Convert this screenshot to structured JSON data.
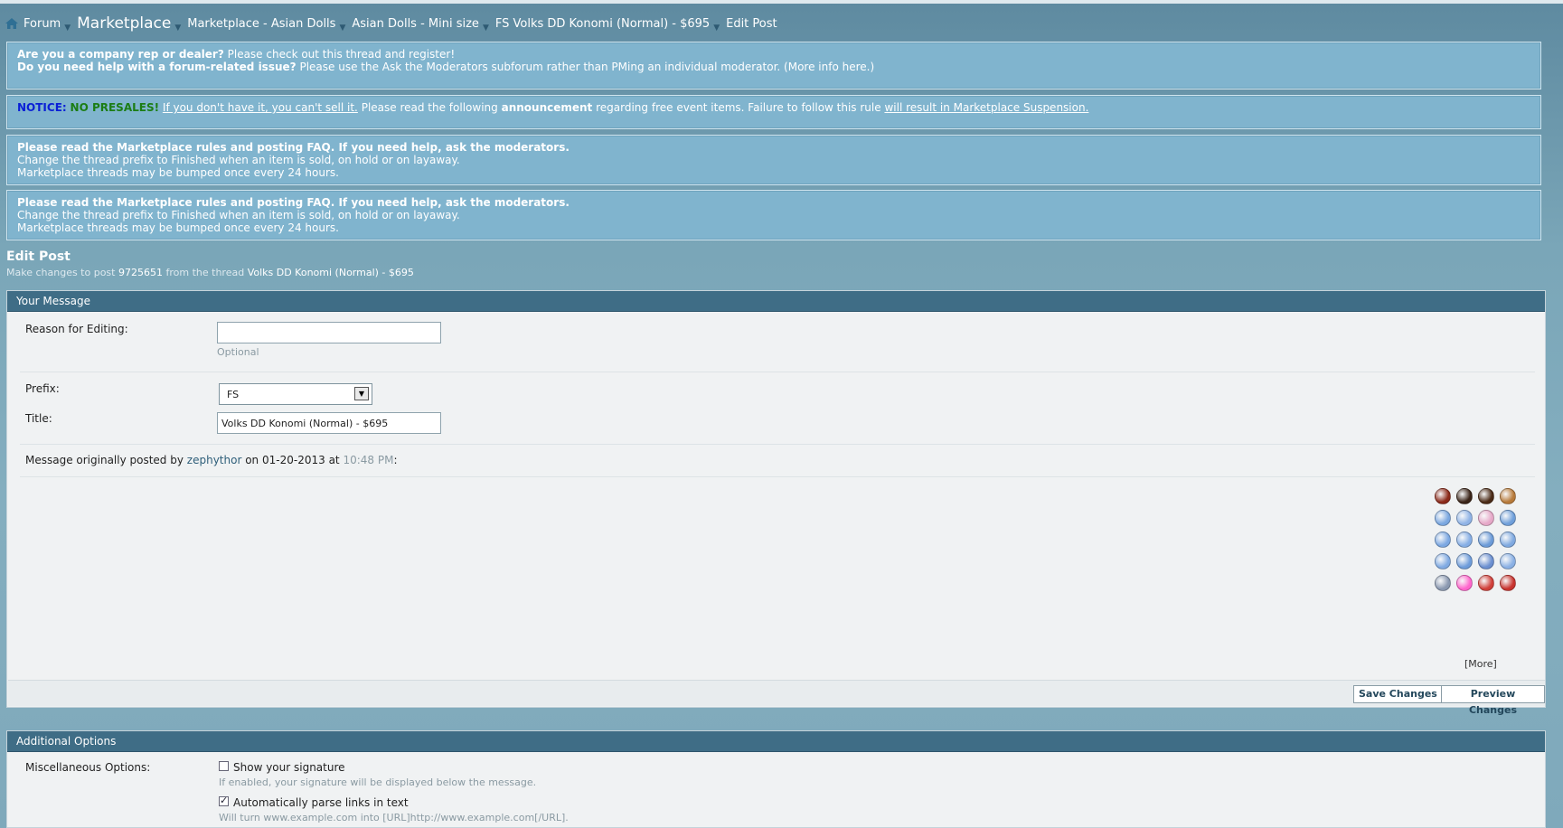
{
  "breadcrumb": {
    "items": [
      "Forum",
      "Marketplace",
      "Marketplace - Asian Dolls",
      "Asian Dolls - Mini size",
      "FS Volks DD Konomi (Normal) - $695",
      "Edit Post"
    ]
  },
  "notices": {
    "n1": {
      "line1_bold": "Are you a company rep or dealer?",
      "line1_text": "Please check out this thread and register!",
      "line2_bold": "Do you need help with a forum-related issue?",
      "line2_text": "Please use the Ask the Moderators subforum rather than PMing an individual moderator. (More info here.)"
    },
    "n2": {
      "notice": "NOTICE:",
      "no_presales": "NO PRESALES!",
      "link1": "If you don't have it, you can't sell it.",
      "text1": "Please read the following",
      "announcement": "announcement",
      "text2": "regarding free event items. Failure to follow this rule",
      "link2": "will result in Marketplace Suspension."
    },
    "n3": {
      "title": "Please read the Marketplace rules and posting FAQ. If you need help, ask the moderators.",
      "line2": "Change the thread prefix to Finished when an item is sold, on hold or on layaway.",
      "line3": "Marketplace threads may be bumped once every 24 hours."
    },
    "n4": {
      "title": "Please read the Marketplace rules and posting FAQ. If you need help, ask the moderators.",
      "line2": "Change the thread prefix to Finished when an item is sold, on hold or on layaway.",
      "line3": "Marketplace threads may be bumped once every 24 hours."
    }
  },
  "edit_post": {
    "title": "Edit Post",
    "desc_prefix": "Make changes to post",
    "post_id": "9725651",
    "desc_mid": "from the thread",
    "thread": "Volks DD Konomi (Normal) - $695"
  },
  "message_panel": {
    "title": "Your Message",
    "reason_label": "Reason for Editing:",
    "reason_value": "",
    "reason_hint": "Optional",
    "prefix_label": "Prefix:",
    "prefix_value": "FS",
    "title_label": "Title:",
    "title_value": "Volks DD Konomi (Normal) - $695",
    "orig_prefix": "Message originally posted by",
    "orig_user": "zephythor",
    "orig_on": "on",
    "orig_date": "01-20-2013",
    "orig_at": "at",
    "orig_time": "10:48 PM",
    "orig_colon": ":",
    "more_label": "[More]",
    "save_label": "Save Changes",
    "preview_label": "Preview Changes"
  },
  "smilies": [
    {
      "name": "smilie-chocolate-strawberry",
      "color": "#8b2a1a"
    },
    {
      "name": "smilie-chocolate-dipped",
      "color": "#3a2418"
    },
    {
      "name": "smilie-chocolate-truffle",
      "color": "#4a2a16"
    },
    {
      "name": "smilie-cream-puff",
      "color": "#b77a3a"
    },
    {
      "name": "smilie-blue-face-1",
      "color": "#7aa7e0"
    },
    {
      "name": "smilie-blue-face-2",
      "color": "#8fb3e6"
    },
    {
      "name": "smilie-pink-face",
      "color": "#e6a8c8"
    },
    {
      "name": "smilie-blue-face-3",
      "color": "#6f9fda"
    },
    {
      "name": "smilie-blue-face-4",
      "color": "#7ca8e2"
    },
    {
      "name": "smilie-blue-face-5",
      "color": "#86aee5"
    },
    {
      "name": "smilie-blue-face-6",
      "color": "#6c9bd8"
    },
    {
      "name": "smilie-blue-face-7",
      "color": "#7fa9e0"
    },
    {
      "name": "smilie-blue-face-8",
      "color": "#80aae2"
    },
    {
      "name": "smilie-blue-face-9",
      "color": "#6e9cda"
    },
    {
      "name": "smilie-blue-face-10",
      "color": "#6b8fd0"
    },
    {
      "name": "smilie-blue-face-11",
      "color": "#8ab0e4"
    },
    {
      "name": "smilie-grey-face",
      "color": "#8a98b0"
    },
    {
      "name": "smilie-heart",
      "color": "#ff66cc"
    },
    {
      "name": "smilie-red-face-1",
      "color": "#d0403a"
    },
    {
      "name": "smilie-red-face-2",
      "color": "#c8342f"
    }
  ],
  "options_panel": {
    "title": "Additional Options",
    "misc_label": "Miscellaneous Options:",
    "sig_label": "Show your signature",
    "sig_checked": false,
    "sig_hint": "If enabled, your signature will be displayed below the message.",
    "links_label": "Automatically parse links in text",
    "links_checked": true,
    "links_hint": "Will turn www.example.com into [URL]http://www.example.com[/URL]."
  }
}
